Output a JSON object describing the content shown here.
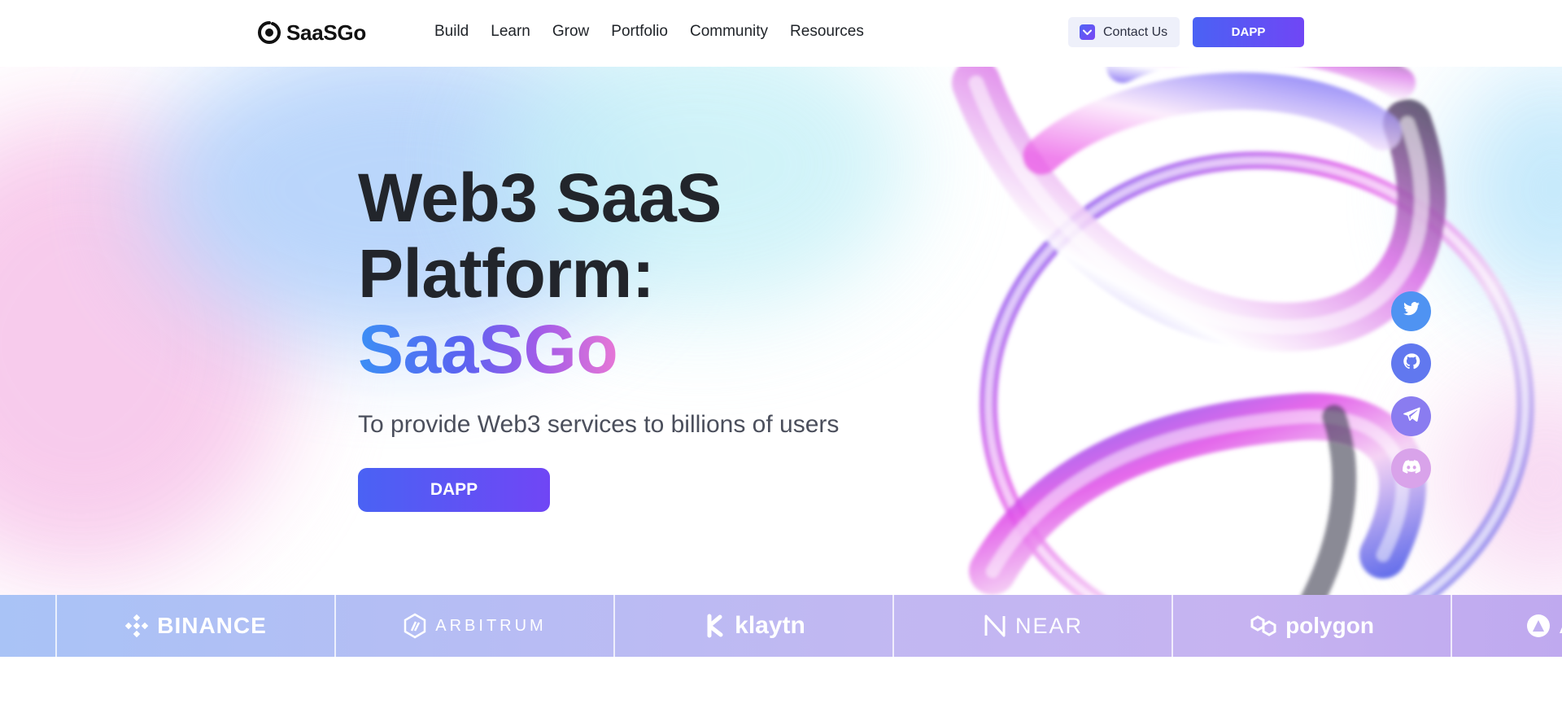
{
  "brand": {
    "name": "SaaSGo"
  },
  "nav": [
    "Build",
    "Learn",
    "Grow",
    "Portfolio",
    "Community",
    "Resources"
  ],
  "header_actions": {
    "contact_label": "Contact Us",
    "dapp_label": "DAPP"
  },
  "hero": {
    "title_line1": "Web3 SaaS",
    "title_line2": "Platform:",
    "title_brand": "SaaSGo",
    "subtitle": "To provide Web3 services to billions of users",
    "cta_label": "DAPP"
  },
  "social": [
    "twitter-icon",
    "github-icon",
    "telegram-icon",
    "discord-icon"
  ],
  "partners": [
    "BINANCE",
    "ARBITRUM",
    "klaytn",
    "NEAR",
    "polygon"
  ],
  "partial_partner_text": "A",
  "colors": {
    "accent_start": "#4a62f4",
    "accent_end": "#7046f5",
    "heading": "#22252b"
  }
}
